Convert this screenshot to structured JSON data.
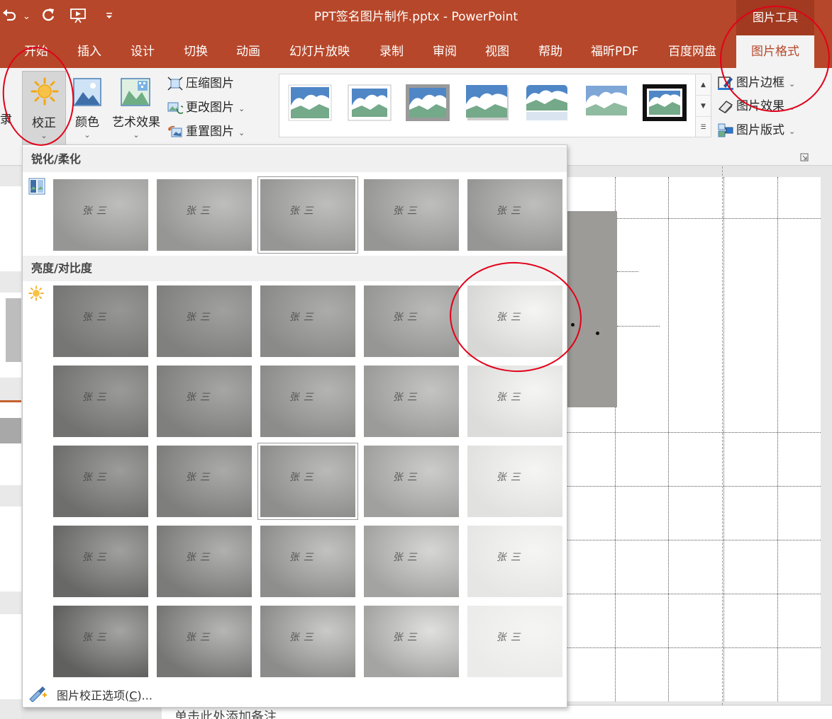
{
  "app": {
    "title": "PPT签名图片制作.pptx  -  PowerPoint",
    "context_tab_group": "图片工具",
    "brand_color": "#b7472a",
    "accent_dark": "#a13a20"
  },
  "qat": {
    "undo_icon": "undo-icon",
    "undo_arrow": "⌄",
    "redo_icon": "redo-icon",
    "present_icon": "slideshow-from-start-icon",
    "customize_icon": "customize-qat-icon"
  },
  "tabs": [
    {
      "label": "开始",
      "active": false
    },
    {
      "label": "插入",
      "active": false
    },
    {
      "label": "设计",
      "active": false
    },
    {
      "label": "切换",
      "active": false
    },
    {
      "label": "动画",
      "active": false
    },
    {
      "label": "幻灯片放映",
      "active": false
    },
    {
      "label": "录制",
      "active": false
    },
    {
      "label": "审阅",
      "active": false
    },
    {
      "label": "视图",
      "active": false
    },
    {
      "label": "帮助",
      "active": false
    },
    {
      "label": "福昕PDF",
      "active": false
    },
    {
      "label": "百度网盘",
      "active": false
    },
    {
      "label": "图片格式",
      "active": true
    }
  ],
  "ribbon": {
    "cut_off_label": "隶",
    "corrections": {
      "label": "校正",
      "icon": "sun-icon"
    },
    "color": {
      "label": "颜色",
      "icon": "picture-color-icon"
    },
    "artistic": {
      "label": "艺术效果",
      "icon": "artistic-effects-icon"
    },
    "compress": {
      "label": "压缩图片",
      "icon": "compress-pictures-icon"
    },
    "change": {
      "label": "更改图片",
      "icon": "change-picture-icon"
    },
    "reset": {
      "label": "重置图片",
      "icon": "reset-picture-icon"
    },
    "border": {
      "label": "图片边框",
      "icon": "picture-border-icon"
    },
    "effects": {
      "label": "图片效果",
      "icon": "picture-effects-icon"
    },
    "layout": {
      "label": "图片版式",
      "icon": "picture-layout-icon"
    },
    "dropdown_arrow": "⌄",
    "styles": [
      "simple-frame-white",
      "soft-edge-white",
      "simple-frame-black",
      "drop-shadow",
      "reflected-rounded",
      "soft-edge",
      "thick-black-frame"
    ]
  },
  "dropdown": {
    "section_sharpen": "锐化/柔化",
    "section_brightness": "亮度/对比度",
    "sharpen_icon": "sharpen-soften-icon",
    "brightness_icon": "brightness-sun-icon",
    "signature_text": "张三",
    "sharpen_selected_index": 2,
    "brightness_selected_index": 12,
    "options_label": "图片校正选项(",
    "options_key": "C",
    "options_suffix": ")...",
    "options_icon": "picture-corrections-options-icon"
  },
  "notes": {
    "placeholder": "单击此处添加备注"
  }
}
